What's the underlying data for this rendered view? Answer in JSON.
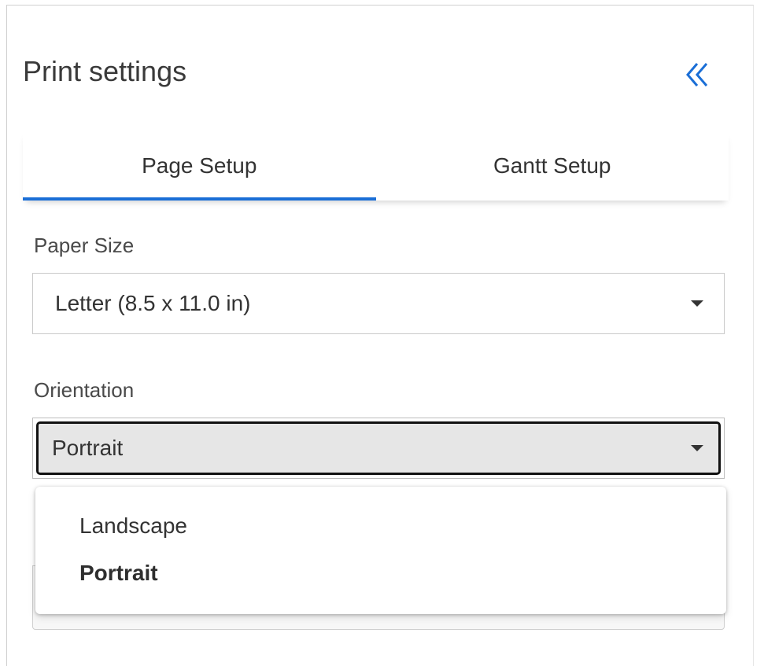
{
  "panel": {
    "title": "Print settings",
    "collapse_icon": "double-chevron-left-icon",
    "accent_color": "#1a6ed6"
  },
  "tabs": [
    {
      "label": "Page Setup",
      "active": true
    },
    {
      "label": "Gantt Setup",
      "active": false
    }
  ],
  "paper_size": {
    "label": "Paper Size",
    "value": "Letter (8.5 x 11.0 in)"
  },
  "orientation": {
    "label": "Orientation",
    "value": "Portrait",
    "options": [
      {
        "label": "Landscape",
        "selected": false
      },
      {
        "label": "Portrait",
        "selected": true
      }
    ]
  }
}
